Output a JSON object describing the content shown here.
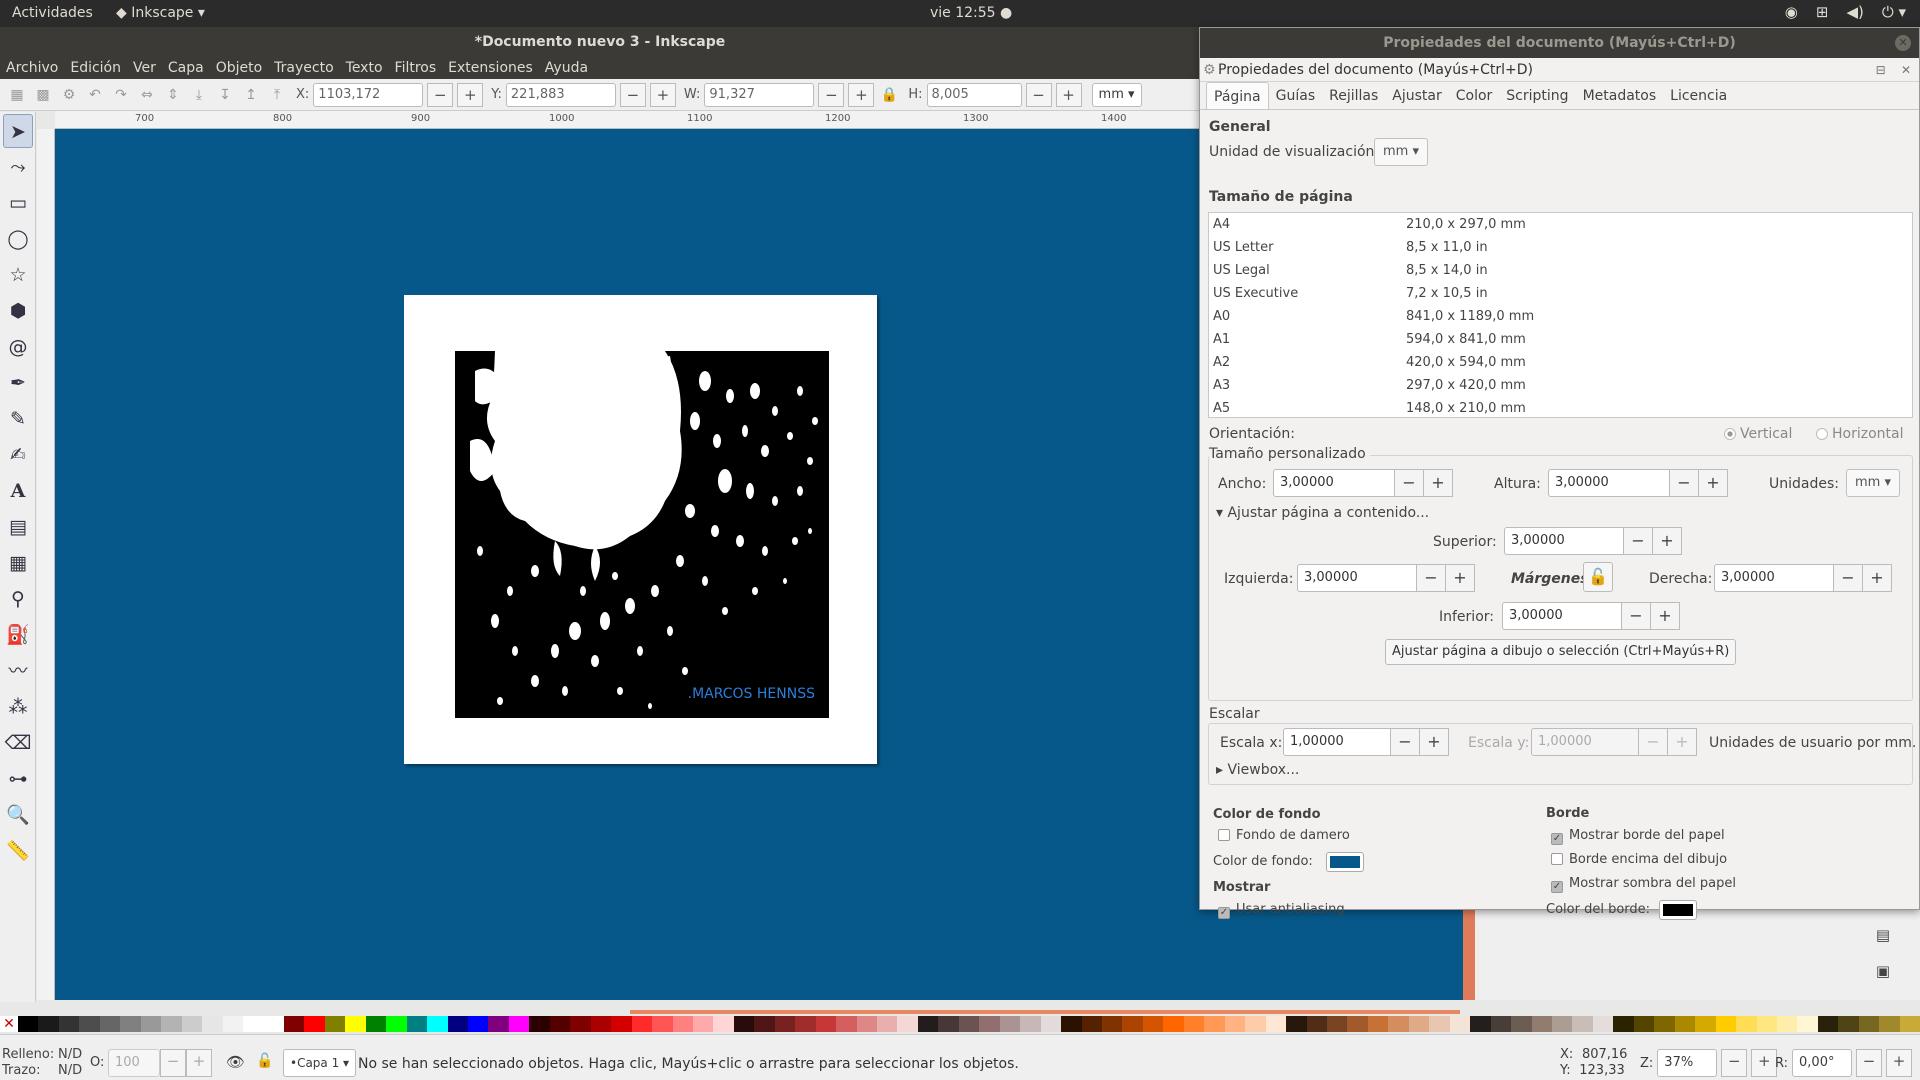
{
  "topbar": {
    "activities": "Actividades",
    "app_name": "Inkscape",
    "clock": "vie 12:55 ●"
  },
  "window": {
    "title": "*Documento nuevo 3 - Inkscape"
  },
  "menu": [
    "Archivo",
    "Edición",
    "Ver",
    "Capa",
    "Objeto",
    "Trayecto",
    "Texto",
    "Filtros",
    "Extensiones",
    "Ayuda"
  ],
  "toolbar": {
    "x_label": "X:",
    "x_value": "1103,172",
    "y_label": "Y:",
    "y_value": "221,883",
    "w_label": "W:",
    "w_value": "91,327",
    "h_label": "H:",
    "h_value": "8,005",
    "unit": "mm"
  },
  "ruler": {
    "labels": [
      "700",
      "800",
      "900",
      "1000",
      "1100",
      "1200",
      "1300",
      "1400"
    ]
  },
  "canvas": {
    "background": "#07588a",
    "signature": ".MARCOS HENNSS"
  },
  "palette": [
    "#000000",
    "#1a1a1a",
    "#333333",
    "#4d4d4d",
    "#666666",
    "#808080",
    "#999999",
    "#b3b3b3",
    "#cccccc",
    "#e6e6e6",
    "#f2f2f2",
    "#ffffff",
    "#ffffff",
    "#800000",
    "#ff0000",
    "#808000",
    "#ffff00",
    "#008000",
    "#00ff00",
    "#008080",
    "#00ffff",
    "#000080",
    "#0000ff",
    "#800080",
    "#ff00ff",
    "#2b0000",
    "#550000",
    "#800000",
    "#aa0000",
    "#d40000",
    "#ff2a2a",
    "#ff5555",
    "#ff8080",
    "#ffaaaa",
    "#ffd5d5",
    "#280b0b",
    "#501616",
    "#782121",
    "#a02c2c",
    "#c83737",
    "#d35f5f",
    "#de8787",
    "#e9afaf",
    "#f4d7d7",
    "#241c1c",
    "#483737",
    "#6c5353",
    "#916f6f",
    "#ac9393",
    "#c8b7b7",
    "#e3dbdb",
    "#2b1100",
    "#552200",
    "#803300",
    "#aa4400",
    "#d45500",
    "#ff6600",
    "#ff7f2a",
    "#ff9955",
    "#ffb380",
    "#ffccaa",
    "#ffe6d5",
    "#28170b",
    "#502d16",
    "#784421",
    "#a05a2c",
    "#c87137",
    "#d38d5f",
    "#deaa87",
    "#e9c6af",
    "#f4e3d7",
    "#241f1c",
    "#483e37",
    "#6c5d53",
    "#917c6f",
    "#ac9d93",
    "#c8beb7",
    "#e3dedb",
    "#2b2200",
    "#554400",
    "#806600",
    "#aa8800",
    "#d4aa00",
    "#ffcc00",
    "#ffdd55",
    "#ffe680",
    "#ffeeaa",
    "#fff6d5",
    "#28220b",
    "#504416",
    "#786721",
    "#a0892c",
    "#c8ab37"
  ],
  "status": {
    "fill_label": "Relleno:",
    "fill_value": "N/D",
    "stroke_label": "Trazo:",
    "stroke_value": "N/D",
    "opacity_label": "O:",
    "opacity_value": "100",
    "layer": "•Capa 1",
    "message": "No se han seleccionado objetos. Haga clic, Mayús+clic o arrastre para seleccionar los objetos.",
    "x_label": "X:",
    "x": "807,16",
    "y_label": "Y:",
    "y": "123,33",
    "zoom_label": "Z:",
    "zoom": "37%",
    "rot_label": "R:",
    "rotation": "0,00°"
  },
  "docprops": {
    "window_title": "Propiedades del documento (Mayús+Ctrl+D)",
    "panel_title": "Propiedades del documento (Mayús+Ctrl+D)",
    "tabs": [
      "Página",
      "Guías",
      "Rejillas",
      "Ajustar",
      "Color",
      "Scripting",
      "Metadatos",
      "Licencia"
    ],
    "general": "General",
    "display_units_label": "Unidad de visualización:",
    "display_units": "mm",
    "page_size_heading": "Tamaño de página",
    "sizes": [
      {
        "name": "A4",
        "dims": "210,0 x 297,0 mm"
      },
      {
        "name": "US Letter",
        "dims": "8,5 x 11,0 in"
      },
      {
        "name": "US Legal",
        "dims": "8,5 x 14,0 in"
      },
      {
        "name": "US Executive",
        "dims": "7,2 x 10,5 in"
      },
      {
        "name": "A0",
        "dims": "841,0 x 1189,0 mm"
      },
      {
        "name": "A1",
        "dims": "594,0 x 841,0 mm"
      },
      {
        "name": "A2",
        "dims": "420,0 x 594,0 mm"
      },
      {
        "name": "A3",
        "dims": "297,0 x 420,0 mm"
      },
      {
        "name": "A5",
        "dims": "148,0 x 210,0 mm"
      }
    ],
    "orientation_label": "Orientación:",
    "orientation_vertical": "Vertical",
    "orientation_horizontal": "Horizontal",
    "custom_size": "Tamaño personalizado",
    "width_label": "Ancho:",
    "width": "3,00000",
    "height_label": "Altura:",
    "height": "3,00000",
    "units_label": "Unidades:",
    "units": "mm",
    "fit_expander": "Ajustar página a contenido...",
    "top_label": "Superior:",
    "top": "3,00000",
    "left_label": "Izquierda:",
    "left": "3,00000",
    "margins_label": "Márgenes",
    "right_label": "Derecha:",
    "right": "3,00000",
    "bottom_label": "Inferior:",
    "bottom": "3,00000",
    "fit_button": "Ajustar página a dibujo o selección (Ctrl+Mayús+R)",
    "scale_heading": "Escalar",
    "scale_x_label": "Escala x:",
    "scale_x": "1,00000",
    "scale_y_label": "Escala y:",
    "scale_y": "1,00000",
    "user_units": "Unidades de usuario por mm.",
    "viewbox": "Viewbox...",
    "bg_heading": "Color de fondo",
    "checkerboard": "Fondo de damero",
    "bg_color_label": "Color de fondo:",
    "bg_color": "#07588a",
    "display_heading": "Mostrar",
    "antialias": "Usar antialiasing",
    "border_heading": "Borde",
    "show_border": "Mostrar borde del papel",
    "border_on_top": "Borde encima del dibujo",
    "show_shadow": "Mostrar sombra del papel",
    "border_color_label": "Color del borde:",
    "border_color": "#000000"
  }
}
